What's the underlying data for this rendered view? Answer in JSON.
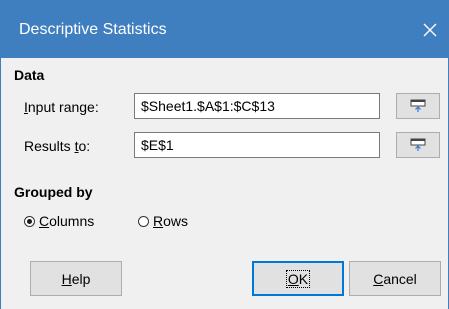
{
  "window": {
    "title": "Descriptive Statistics",
    "close_icon": "close-icon"
  },
  "data_section": {
    "heading": "Data",
    "input_range": {
      "label_mnemonic": "I",
      "label_rest": "nput range:",
      "value": "$Sheet1.$A$1:$C$13"
    },
    "results_to": {
      "label_before": "Results ",
      "label_mnemonic": "t",
      "label_after": "o:",
      "value": "$E$1"
    },
    "shrink_icon": "shrink-range-icon"
  },
  "grouped_by": {
    "heading": "Grouped by",
    "options": [
      {
        "mnemonic": "C",
        "rest": "olumns",
        "selected": true
      },
      {
        "mnemonic": "R",
        "rest": "ows",
        "selected": false
      }
    ]
  },
  "buttons": {
    "help": {
      "mnemonic": "H",
      "rest": "elp"
    },
    "ok": {
      "mnemonic": "O",
      "rest": "K"
    },
    "cancel": {
      "mnemonic": "C",
      "rest": "ancel"
    }
  },
  "colors": {
    "titlebar": "#3f7fc0",
    "dialog_bg": "#f0f0f0",
    "default_button_border": "#0078d7"
  }
}
